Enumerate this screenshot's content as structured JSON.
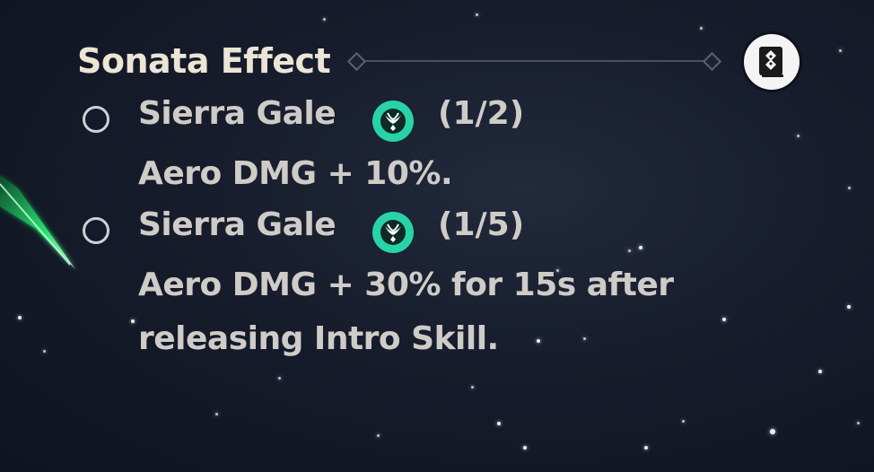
{
  "panel": {
    "title": "Sonata Effect",
    "book_icon": "book-icon",
    "effects": [
      {
        "name": "Sierra Gale",
        "element_icon": "aero-icon",
        "count": "(1/2)",
        "description": "Aero DMG + 10%."
      },
      {
        "name": "Sierra Gale",
        "element_icon": "aero-icon",
        "count": "(1/5)",
        "description": "Aero DMG + 30% for 15s after releasing Intro Skill."
      }
    ]
  },
  "colors": {
    "background": "#161c2b",
    "text": "#cfccc8",
    "title": "#ece5d6",
    "aero_accent": "#29d3a8",
    "blade_glow": "#2ef27a"
  }
}
